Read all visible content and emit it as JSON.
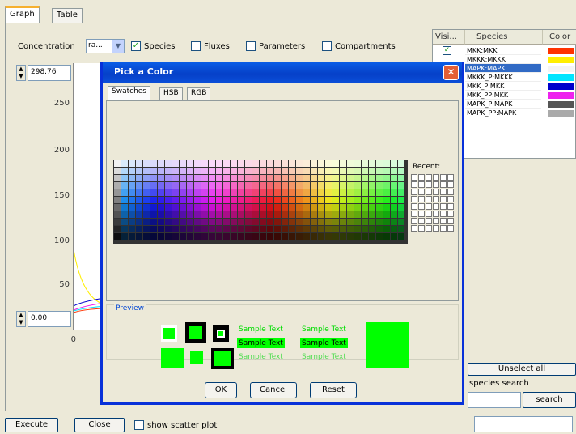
{
  "tabs": {
    "graph": "Graph",
    "table": "Table"
  },
  "toolbar": {
    "concentration_label": "Concentration",
    "concentration_value": "ra...",
    "species_label": "Species",
    "fluxes_label": "Fluxes",
    "parameters_label": "Parameters",
    "compartments_label": "Compartments"
  },
  "plot": {
    "max_value": "298.76",
    "min_value": "0.00",
    "y_ticks": [
      "250",
      "200",
      "150",
      "100",
      "50"
    ],
    "x_tick": "0"
  },
  "species_table": {
    "headers": {
      "visible": "Visi...",
      "species": "Species",
      "color": "Color"
    },
    "rows": [
      {
        "name": "MKK:MKK",
        "color": "#ff3300",
        "checked": true
      },
      {
        "name": "MKKK:MKKK",
        "color": "#ffee00",
        "checked": false
      },
      {
        "name": "MAPK:MAPK",
        "color": "#f4f4f4",
        "checked": false,
        "selected": true
      },
      {
        "name": "MKKK_P:MKKK",
        "color": "#00e5ff",
        "checked": false
      },
      {
        "name": "MKK_P:MKK",
        "color": "#0000cc",
        "checked": false
      },
      {
        "name": "MKK_PP:MKK",
        "color": "#ee22ee",
        "checked": false
      },
      {
        "name": "MAPK_P:MAPK",
        "color": "#555555",
        "checked": false
      },
      {
        "name": "MAPK_PP:MAPK",
        "color": "#aaaaaa",
        "checked": false
      }
    ]
  },
  "right_panel": {
    "unselect_all": "Unselect all",
    "search_label": "species search",
    "search_button": "search"
  },
  "dialog": {
    "title": "Pick a Color",
    "close_glyph": "✕",
    "tabs": [
      "Swatches",
      "HSB",
      "RGB"
    ],
    "recent_label": "Recent:",
    "preview_label": "Preview",
    "sample_text": "Sample Text",
    "buttons": {
      "ok": "OK",
      "cancel": "Cancel",
      "reset": "Reset"
    },
    "selected_color": "#00ff00"
  },
  "bottom_bar": {
    "execute": "Execute",
    "close": "Close",
    "scatter_label": "show scatter plot"
  }
}
